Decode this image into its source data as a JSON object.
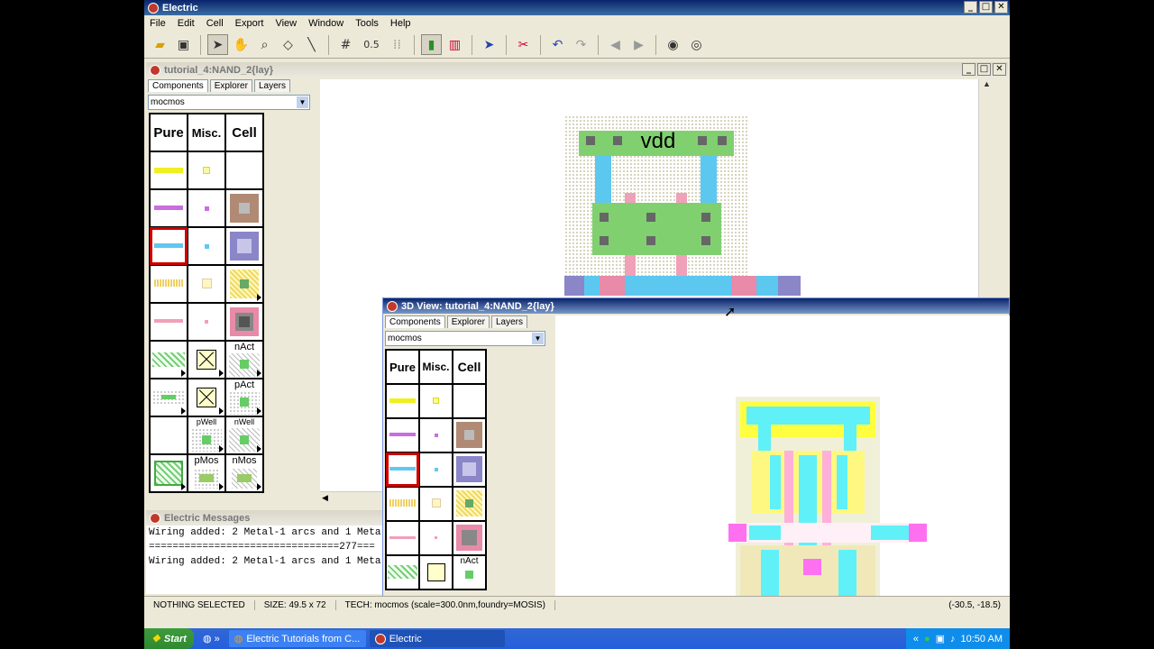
{
  "app": {
    "title": "Electric",
    "colors": {
      "titlebar": "#0a246a",
      "desktop": "#ece9d8"
    }
  },
  "menu": [
    "File",
    "Edit",
    "Cell",
    "Export",
    "View",
    "Window",
    "Tools",
    "Help"
  ],
  "toolbar": {
    "grid_value": "0.5"
  },
  "layout_window": {
    "title": "tutorial_4:NAND_2{lay}"
  },
  "view3d_window": {
    "title": "3D View: tutorial_4:NAND_2{lay}"
  },
  "side_panel": {
    "tabs": [
      "Components",
      "Explorer",
      "Layers"
    ],
    "technology": "mocmos",
    "headers": [
      "Pure",
      "Misc.",
      "Cell"
    ],
    "cell_labels": {
      "nact": "nAct",
      "pact": "pAct",
      "pwell": "pWell",
      "nwell": "nWell",
      "pmos": "pMos",
      "nmos": "nMos"
    }
  },
  "layout_label": "vdd",
  "messages": {
    "title": "Electric Messages",
    "lines": [
      "Wiring added: 2 Metal-1 arcs and 1 Meta",
      "================================277===",
      "Wiring added: 2 Metal-1 arcs and 1 Meta"
    ]
  },
  "status": {
    "selection": "NOTHING SELECTED",
    "size": "SIZE: 49.5 x 72",
    "tech": "TECH: mocmos (scale=300.0nm,foundry=MOSIS)",
    "coords": "(-30.5, -18.5)"
  },
  "taskbar": {
    "start": "Start",
    "task1": "Electric Tutorials from C...",
    "task2": "Electric",
    "time": "10:50 AM"
  }
}
